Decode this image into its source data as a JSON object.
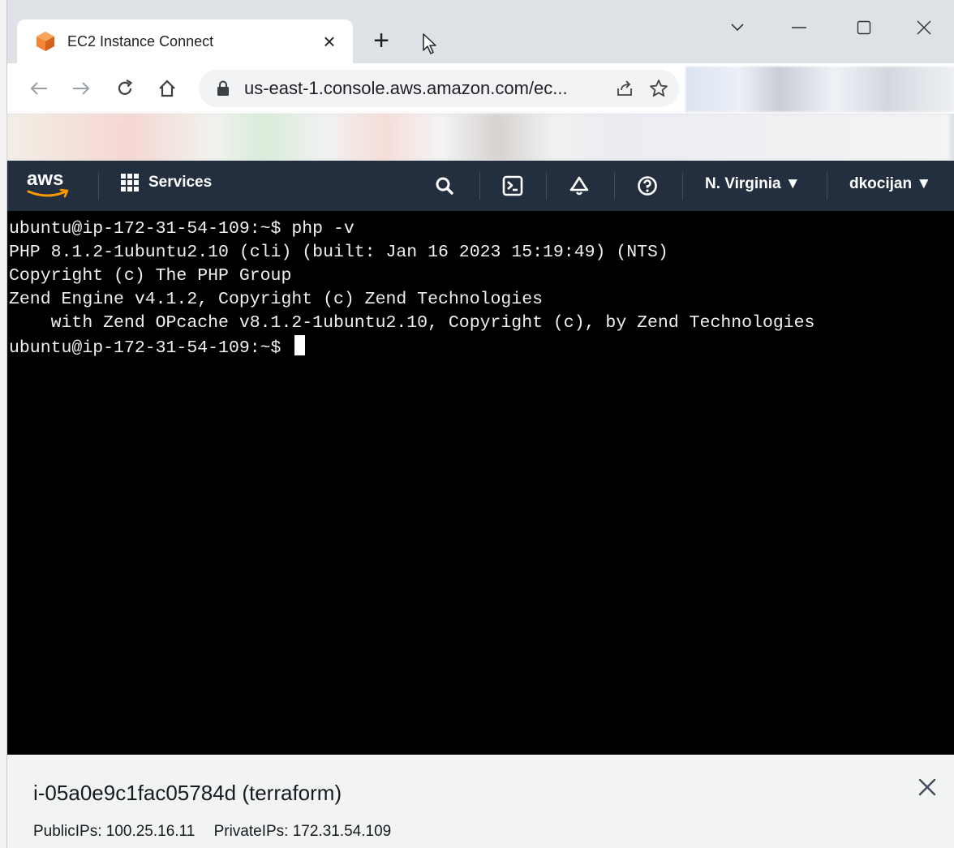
{
  "browser": {
    "tab": {
      "title": "EC2 Instance Connect",
      "close_label": "×"
    },
    "new_tab_label": "+",
    "address": {
      "url": "us-east-1.console.aws.amazon.com/ec..."
    }
  },
  "aws_header": {
    "logo": "aws",
    "services_label": "Services",
    "region_label": "N. Virginia ▼",
    "user_label": "dkocijan ▼"
  },
  "terminal": {
    "lines": [
      "ubuntu@ip-172-31-54-109:~$ php -v",
      "PHP 8.1.2-1ubuntu2.10 (cli) (built: Jan 16 2023 15:19:49) (NTS)",
      "Copyright (c) The PHP Group",
      "Zend Engine v4.1.2, Copyright (c) Zend Technologies",
      "    with Zend OPcache v8.1.2-1ubuntu2.10, Copyright (c), by Zend Technologies",
      "ubuntu@ip-172-31-54-109:~$ "
    ]
  },
  "instance": {
    "title": "i-05a0e9c1fac05784d (terraform)",
    "public_ips": "PublicIPs: 100.25.16.11",
    "private_ips": "PrivateIPs: 172.31.54.109"
  },
  "colors": {
    "aws_header_bg": "#232f3e",
    "aws_orange": "#ff9900",
    "terminal_bg": "#000000",
    "terminal_fg": "#f0f0f0"
  }
}
